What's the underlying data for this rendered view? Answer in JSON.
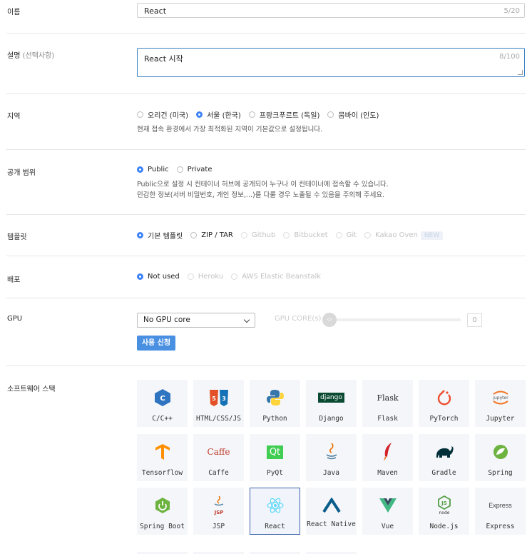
{
  "name_field": {
    "label": "이름",
    "value": "React",
    "counter": "5/20"
  },
  "description_field": {
    "label": "설명",
    "label_sub": "(선택사항)",
    "value": "React 시작",
    "counter": "8/100"
  },
  "region": {
    "label": "지역",
    "options": [
      "오리건 (미국)",
      "서울 (한국)",
      "프랑크푸르트 (독일)",
      "뭄바이 (인도)"
    ],
    "selected": "서울 (한국)",
    "help": "현재 접속 환경에서 가장 최적화된 지역이 기본값으로 설정됩니다."
  },
  "visibility": {
    "label": "공개 범위",
    "options": [
      "Public",
      "Private"
    ],
    "selected": "Public",
    "help_line1": "Public으로 설정 시 컨테이너 허브에 공개되어 누구나 이 컨테이너에 접속할 수 있습니다.",
    "help_line2": "민감한 정보(서버 비밀번호, 개인 정보,...)를 다룰 경우 노출될 수 있음을 주의해 주세요."
  },
  "template": {
    "label": "템플릿",
    "options": [
      "기본 템플릿",
      "ZIP / TAR",
      "Github",
      "Bitbucket",
      "Git",
      "Kakao Oven"
    ],
    "selected": "기본 템플릿",
    "badge": "NEW"
  },
  "deploy": {
    "label": "배포",
    "options": [
      "Not used",
      "Heroku",
      "AWS Elastic Beanstalk"
    ],
    "selected": "Not used"
  },
  "gpu": {
    "label": "GPU",
    "select_value": "No GPU core",
    "core_label": "GPU CORE(s)",
    "core_value": "0",
    "knob_glyph": "‹›",
    "apply_button": "사용 신청"
  },
  "software_stack": {
    "label": "소프트웨어 스택",
    "selected": "React",
    "items": [
      {
        "name": "C/C++",
        "icon": "cpp-icon"
      },
      {
        "name": "HTML/CSS/JS",
        "icon": "html-css-icon"
      },
      {
        "name": "Python",
        "icon": "python-icon"
      },
      {
        "name": "Django",
        "icon": "django-icon",
        "icon_text": "django"
      },
      {
        "name": "Flask",
        "icon": "flask-icon",
        "icon_text": "Flask"
      },
      {
        "name": "PyTorch",
        "icon": "pytorch-icon"
      },
      {
        "name": "Jupyter",
        "icon": "jupyter-icon",
        "icon_text": "jupyter"
      },
      {
        "name": "Tensorflow",
        "icon": "tensorflow-icon"
      },
      {
        "name": "Caffe",
        "icon": "caffe-icon",
        "icon_text": "Caffe"
      },
      {
        "name": "PyQt",
        "icon": "qt-icon",
        "icon_text": "Qt"
      },
      {
        "name": "Java",
        "icon": "java-icon"
      },
      {
        "name": "Maven",
        "icon": "maven-icon"
      },
      {
        "name": "Gradle",
        "icon": "gradle-icon"
      },
      {
        "name": "Spring",
        "icon": "spring-icon"
      },
      {
        "name": "Spring Boot",
        "icon": "spring-boot-icon"
      },
      {
        "name": "JSP",
        "icon": "jsp-icon",
        "icon_text": "JSP"
      },
      {
        "name": "React",
        "icon": "react-icon"
      },
      {
        "name": "React Native",
        "icon": "react-native-icon"
      },
      {
        "name": "Vue",
        "icon": "vue-icon"
      },
      {
        "name": "Node.js",
        "icon": "nodejs-icon",
        "icon_text": "node"
      },
      {
        "name": "Express",
        "icon": "express-icon",
        "icon_text": "Express"
      }
    ]
  },
  "colors": {
    "accent": "#3b82f6",
    "button": "#4a90e2",
    "tile_bg": "#f4f6f9",
    "selected_border": "#3b62a8"
  }
}
